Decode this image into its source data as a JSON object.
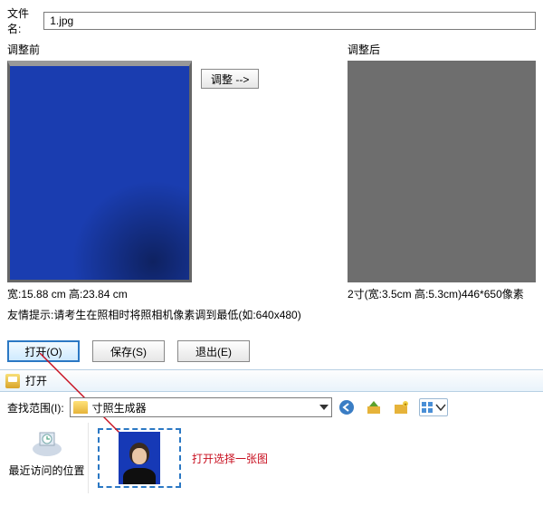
{
  "filename": {
    "label": "文件名:",
    "value": "1.jpg"
  },
  "compare": {
    "before_label": "调整前",
    "after_label": "调整后",
    "adjust_button": "调整 -->",
    "before_dim": "宽:15.88 cm 高:23.84 cm",
    "after_dim": "2寸(宽:3.5cm 高:5.3cm)446*650像素"
  },
  "tip": "友情提示:请考生在照相时将照相机像素调到最低(如:640x480)",
  "buttons": {
    "open": "打开(O)",
    "save": "保存(S)",
    "exit": "退出(E)"
  },
  "dialog": {
    "title": "打开",
    "lookup_label": "查找范围(I):",
    "folder": "寸照生成器",
    "places": {
      "recent": "最近访问的位置"
    },
    "note": "打开选择一张图"
  },
  "icons": {
    "back": "back-icon",
    "up": "up-icon",
    "new_folder": "new-folder-icon",
    "view": "view-menu-icon"
  }
}
